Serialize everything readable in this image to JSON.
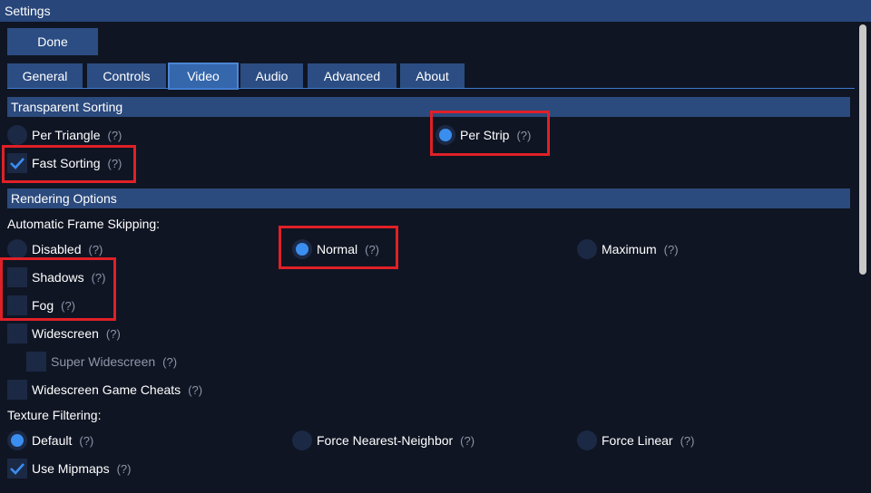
{
  "window": {
    "title": "Settings"
  },
  "done_label": "Done",
  "tabs": [
    {
      "label": "General",
      "active": false
    },
    {
      "label": "Controls",
      "active": false
    },
    {
      "label": "Video",
      "active": true
    },
    {
      "label": "Audio",
      "active": false
    },
    {
      "label": "Advanced",
      "active": false
    },
    {
      "label": "About",
      "active": false
    }
  ],
  "help_text": "(?)",
  "transparent_sorting": {
    "header": "Transparent Sorting",
    "per_triangle": {
      "label": "Per Triangle",
      "checked": false
    },
    "per_strip": {
      "label": "Per Strip",
      "checked": true
    },
    "fast_sorting": {
      "label": "Fast Sorting",
      "checked": true
    }
  },
  "rendering": {
    "header": "Rendering Options",
    "frame_skipping_label": "Automatic Frame Skipping:",
    "disabled": {
      "label": "Disabled",
      "checked": false
    },
    "normal": {
      "label": "Normal",
      "checked": true
    },
    "maximum": {
      "label": "Maximum",
      "checked": false
    },
    "shadows": {
      "label": "Shadows",
      "checked": false
    },
    "fog": {
      "label": "Fog",
      "checked": false
    },
    "widescreen": {
      "label": "Widescreen",
      "checked": false
    },
    "super_widescreen": {
      "label": "Super Widescreen",
      "checked": false,
      "enabled": false
    },
    "widescreen_cheats": {
      "label": "Widescreen Game Cheats",
      "checked": false
    },
    "texture_filtering_label": "Texture Filtering:",
    "tf_default": {
      "label": "Default",
      "checked": true
    },
    "tf_nearest": {
      "label": "Force Nearest-Neighbor",
      "checked": false
    },
    "tf_linear": {
      "label": "Force Linear",
      "checked": false
    },
    "use_mipmaps": {
      "label": "Use Mipmaps",
      "checked": true
    }
  },
  "colors": {
    "titlebar": "#28467a",
    "background": "#0f1523",
    "button": "#2c4d83",
    "section_header": "#2b4a7d",
    "control": "#1c2945",
    "accent": "#3a8ef0",
    "highlight": "#e02027"
  }
}
